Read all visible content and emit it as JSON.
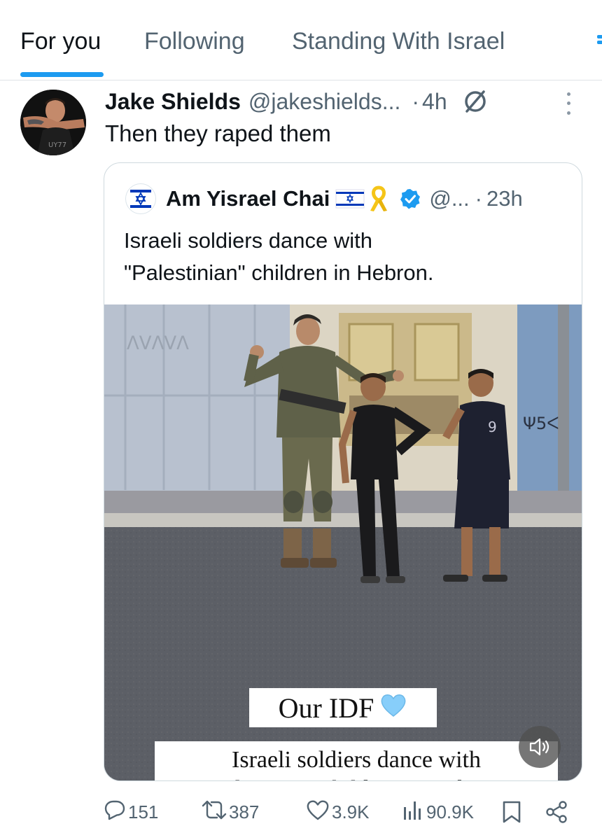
{
  "tabs": [
    {
      "label": "For you",
      "active": true
    },
    {
      "label": "Following",
      "active": false
    },
    {
      "label": "Standing With Israel",
      "active": false
    }
  ],
  "post": {
    "author_name": "Jake Shields",
    "author_handle": "@jakeshields...",
    "time_sep": "·",
    "time": "4h",
    "text": "Then they raped them"
  },
  "quote": {
    "author_name": "Am Yisrael Chai",
    "author_handle": "@...",
    "time_sep": "·",
    "time": "23h",
    "text_line1": "Israeli soldiers dance with",
    "text_line2": "\"Palestinian\" children in Hebron.",
    "video_caption_1": "Our IDF",
    "video_caption_2": "Israeli soldiers dance with",
    "video_caption_2_cut": "Palestinian children in Hebron",
    "wall_graffiti": "Ψ5ᐸ"
  },
  "actions": {
    "replies": "151",
    "reposts": "387",
    "likes": "3.9K",
    "views": "90.9K"
  },
  "icons": {
    "reply": "reply-icon",
    "repost": "repost-icon",
    "like": "heart-icon",
    "views": "views-icon",
    "bookmark": "bookmark-icon",
    "share": "share-icon",
    "more": "more-icon",
    "mute": "sound-off-icon",
    "verified": "verified-badge-icon"
  },
  "colors": {
    "accent": "#1d9bf0",
    "text": "#0f1419",
    "secondary": "#536471",
    "border": "#cfd9de",
    "verified": "#1d9bf0",
    "heart_emoji": "#87cefa"
  }
}
